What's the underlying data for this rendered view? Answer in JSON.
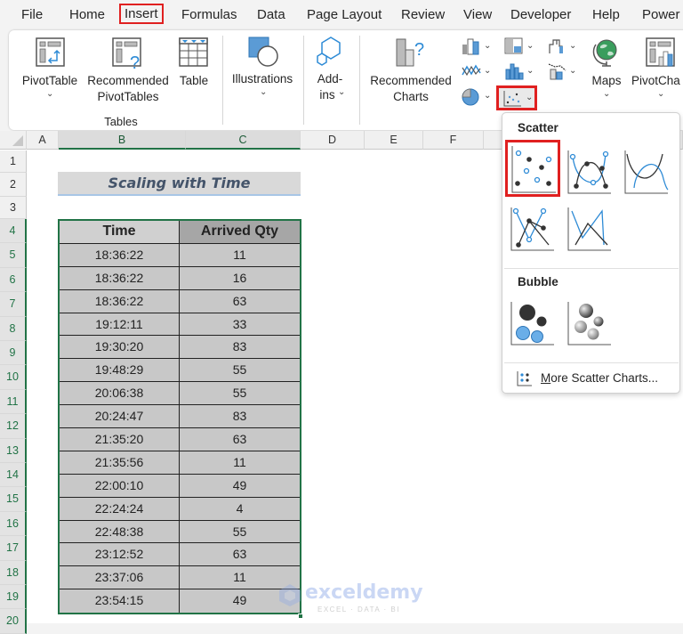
{
  "menu": {
    "tabs": [
      "File",
      "Home",
      "Insert",
      "Formulas",
      "Data",
      "Page Layout",
      "Review",
      "View",
      "Developer",
      "Help",
      "Power"
    ],
    "active": "Insert"
  },
  "ribbon": {
    "pivottable": "PivotTable",
    "recommended_pivottables_1": "Recommended",
    "recommended_pivottables_2": "PivotTables",
    "table": "Table",
    "tables_group": "Tables",
    "illustrations": "Illustrations",
    "addins_1": "Add-",
    "addins_2": "ins",
    "recommended_charts_1": "Recommended",
    "recommended_charts_2": "Charts",
    "maps": "Maps",
    "pivotchart": "PivotCha",
    "chevron": "⌄"
  },
  "columns": [
    "A",
    "B",
    "C",
    "D",
    "E",
    "F"
  ],
  "rows": [
    "1",
    "2",
    "3",
    "4",
    "5",
    "6",
    "7",
    "8",
    "9",
    "10",
    "11",
    "12",
    "13",
    "14",
    "15",
    "16",
    "17",
    "18",
    "19",
    "20"
  ],
  "sheet": {
    "title": "Scaling with Time",
    "headers": [
      "Time",
      "Arrived Qty"
    ],
    "data": [
      [
        "18:36:22",
        "11"
      ],
      [
        "18:36:22",
        "16"
      ],
      [
        "18:36:22",
        "63"
      ],
      [
        "19:12:11",
        "33"
      ],
      [
        "19:30:20",
        "83"
      ],
      [
        "19:48:29",
        "55"
      ],
      [
        "20:06:38",
        "55"
      ],
      [
        "20:24:47",
        "83"
      ],
      [
        "21:35:20",
        "63"
      ],
      [
        "21:35:56",
        "11"
      ],
      [
        "22:00:10",
        "49"
      ],
      [
        "22:24:24",
        "4"
      ],
      [
        "22:48:38",
        "55"
      ],
      [
        "23:12:52",
        "63"
      ],
      [
        "23:37:06",
        "11"
      ],
      [
        "23:54:15",
        "49"
      ]
    ]
  },
  "dropdown": {
    "scatter_heading": "Scatter",
    "bubble_heading": "Bubble",
    "more_label_u": "M",
    "more_label_rest": "ore Scatter Charts...",
    "scatter_items": [
      "scatter",
      "scatter-smooth-lines-markers",
      "scatter-smooth-lines",
      "scatter-straight-lines-markers",
      "scatter-straight-lines"
    ],
    "bubble_items": [
      "bubble",
      "3d-bubble"
    ]
  },
  "watermark": {
    "brand": "exceldemy",
    "tagline": "EXCEL · DATA · BI"
  },
  "colors": {
    "accent_green": "#217346",
    "highlight_red": "#e02020",
    "chart_blue": "#2e8bd6"
  }
}
